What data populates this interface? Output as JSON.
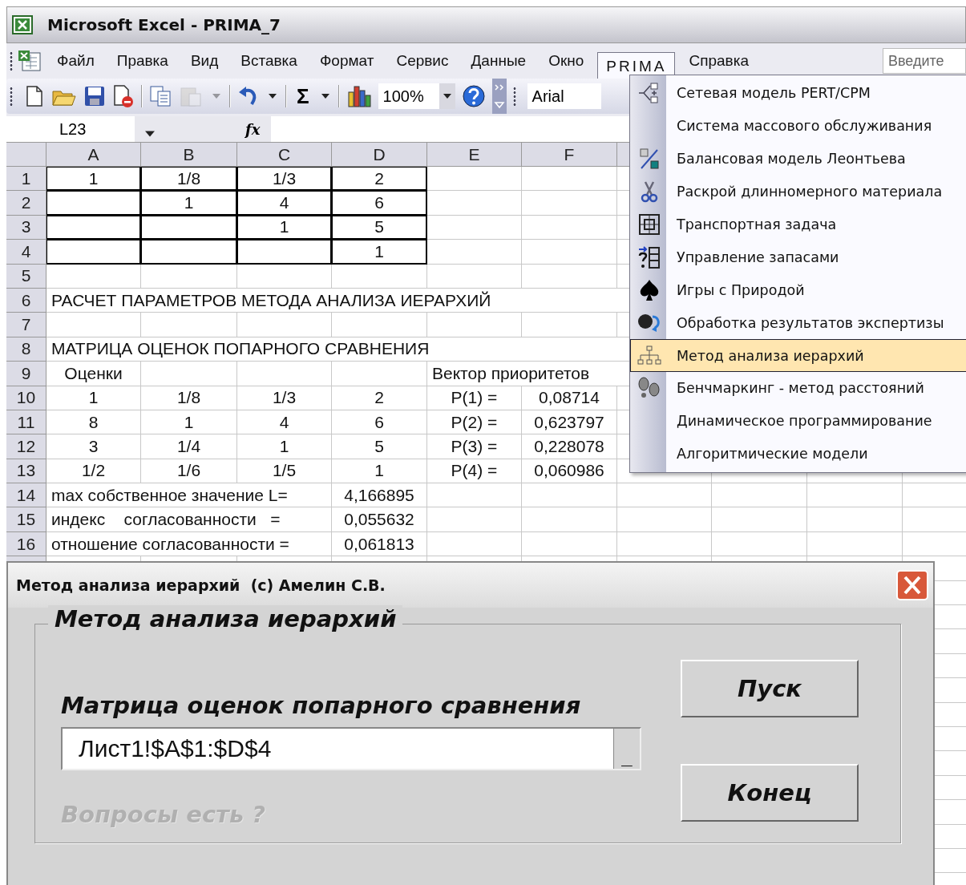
{
  "window": {
    "title": "Microsoft Excel - PRIMA_7"
  },
  "menu_bar": {
    "items": [
      {
        "label": "Файл",
        "selected": false
      },
      {
        "label": "Правка",
        "selected": false
      },
      {
        "label": "Вид",
        "selected": false
      },
      {
        "label": "Вставка",
        "selected": false
      },
      {
        "label": "Формат",
        "selected": false
      },
      {
        "label": "Сервис",
        "selected": false
      },
      {
        "label": "Данные",
        "selected": false
      },
      {
        "label": "Окно",
        "selected": false
      },
      {
        "label": "PRIMA",
        "selected": true
      },
      {
        "label": "Справка",
        "selected": false
      }
    ],
    "help_box": {
      "placeholder": "Введите"
    }
  },
  "toolbar": {
    "groups": [
      [
        {
          "kind": "new",
          "disabled": false
        },
        {
          "kind": "open",
          "disabled": false
        },
        {
          "kind": "save",
          "disabled": false
        },
        {
          "kind": "preview",
          "disabled": false
        }
      ],
      [
        {
          "kind": "copy",
          "disabled": false
        },
        {
          "kind": "paste",
          "disabled": true
        },
        {
          "kind": "dropdown",
          "disabled": true
        }
      ],
      [
        {
          "kind": "undo",
          "disabled": false
        },
        {
          "kind": "dropdown",
          "disabled": false
        }
      ],
      [
        {
          "kind": "symbol",
          "text": "Σ",
          "disabled": false
        },
        {
          "kind": "dropdown",
          "disabled": false
        }
      ],
      [
        {
          "kind": "chart",
          "disabled": false
        },
        {
          "kind": "combo",
          "value": "100%",
          "disabled": false
        },
        {
          "kind": "help",
          "disabled": false
        }
      ]
    ],
    "font_field": "Arial"
  },
  "formula_bar": {
    "name_box": "L23",
    "function_label": "fx"
  },
  "sheet": {
    "columns": [
      "A",
      "B",
      "C",
      "D",
      "E",
      "F"
    ],
    "rows": [
      {
        "header": "1",
        "cells": [
          {
            "value": "1",
            "boxed": true
          },
          {
            "value": "1/8",
            "boxed": true
          },
          {
            "value": "1/3",
            "boxed": true
          },
          {
            "value": "2",
            "boxed": true
          }
        ]
      },
      {
        "header": "2",
        "cells": [
          {
            "boxed": true
          },
          {
            "value": "1",
            "boxed": true
          },
          {
            "value": "4",
            "boxed": true
          },
          {
            "value": "6",
            "boxed": true
          }
        ]
      },
      {
        "header": "3",
        "cells": [
          {
            "boxed": true
          },
          {
            "boxed": true
          },
          {
            "value": "1",
            "boxed": true
          },
          {
            "value": "5",
            "boxed": true
          }
        ]
      },
      {
        "header": "4",
        "cells": [
          {
            "boxed": true
          },
          {
            "boxed": true
          },
          {
            "boxed": true
          },
          {
            "value": "1",
            "boxed": true
          }
        ]
      },
      {
        "header": "5",
        "cells": []
      },
      {
        "header": "6",
        "cells": [
          {
            "value": "РАСЧЕТ ПАРАМЕТРОВ МЕТОДА АНАЛИЗА ИЕРАРХИЙ",
            "spill": true
          }
        ]
      },
      {
        "header": "7",
        "cells": []
      },
      {
        "header": "8",
        "cells": [
          {
            "value": "МАТРИЦА ОЦЕНОК ПОПАРНОГО СРАВНЕНИЯ",
            "spill": true
          }
        ]
      },
      {
        "header": "9",
        "cells": [
          {
            "value": "Оценки"
          },
          null,
          null,
          null,
          {
            "value": "Вектор приоритетов",
            "spill": true
          }
        ]
      },
      {
        "header": "10",
        "cells": [
          {
            "value": "1"
          },
          {
            "value": "1/8"
          },
          {
            "value": "1/3"
          },
          {
            "value": "2"
          },
          {
            "value": "P(1) ="
          },
          {
            "value": "0,08714"
          }
        ]
      },
      {
        "header": "11",
        "cells": [
          {
            "value": "8"
          },
          {
            "value": "1"
          },
          {
            "value": "4"
          },
          {
            "value": "6"
          },
          {
            "value": "P(2) ="
          },
          {
            "value": "0,623797"
          }
        ]
      },
      {
        "header": "12",
        "cells": [
          {
            "value": "3"
          },
          {
            "value": "1/4"
          },
          {
            "value": "1"
          },
          {
            "value": "5"
          },
          {
            "value": "P(3) ="
          },
          {
            "value": "0,228078"
          }
        ]
      },
      {
        "header": "13",
        "cells": [
          {
            "value": "1/2"
          },
          {
            "value": "1/6"
          },
          {
            "value": "1/5"
          },
          {
            "value": "1"
          },
          {
            "value": "P(4) ="
          },
          {
            "value": "0,060986"
          }
        ]
      },
      {
        "header": "14",
        "cells": [
          {
            "value": "max собственное значение L=",
            "spill": true
          },
          null,
          null,
          {
            "value": "4,166895"
          }
        ]
      },
      {
        "header": "15",
        "cells": [
          {
            "value": "индекс    согласованности   =",
            "spill": true
          },
          null,
          null,
          {
            "value": "0,055632"
          }
        ]
      },
      {
        "header": "16",
        "cells": [
          {
            "value": "отношение согласованности =",
            "spill": true
          },
          null,
          null,
          {
            "value": "0,061813"
          }
        ]
      }
    ]
  },
  "prima_menu": {
    "items": [
      {
        "label": "Сетевая модель PERT/CPM",
        "kind": "network",
        "selected": false
      },
      {
        "label": "Система массового обслуживания",
        "kind": "none",
        "selected": false
      },
      {
        "label": "Балансовая модель Леонтьева",
        "kind": "balance",
        "selected": false
      },
      {
        "label": "Раскрой длинномерного материала",
        "kind": "scissors",
        "selected": false
      },
      {
        "label": "Транспортная задача",
        "kind": "transport",
        "selected": false
      },
      {
        "label": "Управление запасами",
        "kind": "stock",
        "selected": false
      },
      {
        "label": "Игры с Природой",
        "kind": "spade",
        "selected": false
      },
      {
        "label": "Обработка результатов экспертизы",
        "kind": "expert",
        "selected": false
      },
      {
        "label": "Метод анализа иерархий",
        "kind": "hierarchy",
        "selected": true
      },
      {
        "label": "Бенчмаркинг - метод расстояний",
        "kind": "steps",
        "selected": false
      },
      {
        "label": "Динамическое программирование",
        "kind": "none",
        "selected": false
      },
      {
        "label": "Алгоритмические модели",
        "kind": "none",
        "selected": false
      }
    ]
  },
  "dialog": {
    "title": "Метод анализа иерархий  (c) Амелин С.В.",
    "group_title": "Метод анализа иерархий",
    "range_label": "Матрица оценок попарного сравнения",
    "range_value": "Лист1!$A$1:$D$4",
    "range_button": "_",
    "hint": {
      "text": "Вопросы есть ?",
      "disabled": true
    },
    "buttons": [
      "Пуск",
      "Конец"
    ]
  }
}
